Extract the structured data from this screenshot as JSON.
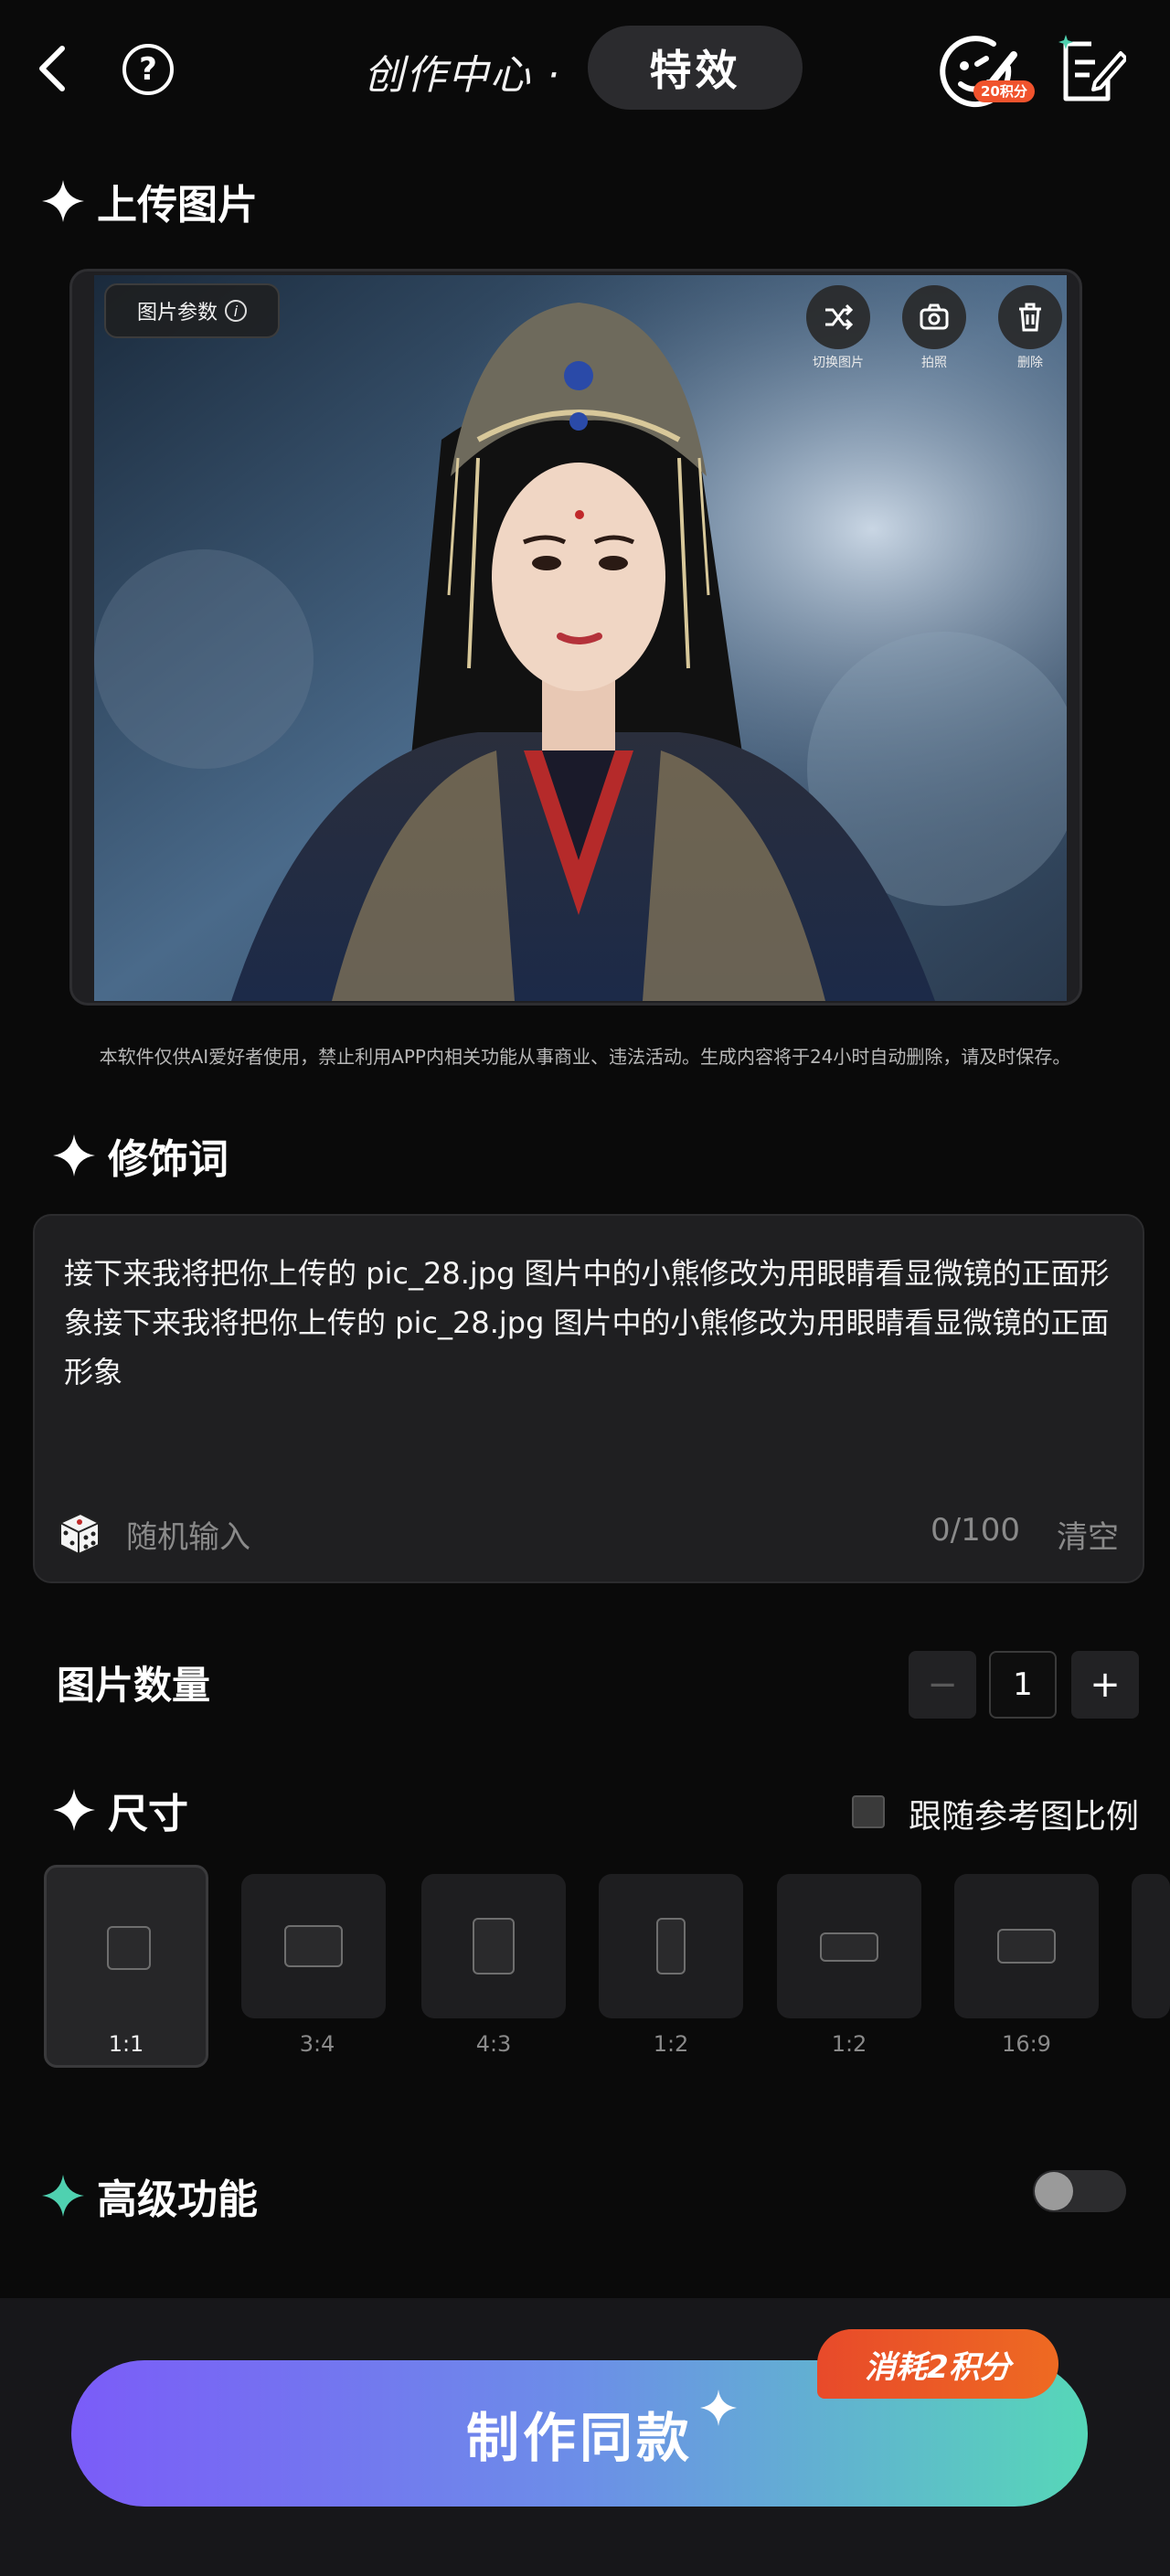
{
  "header": {
    "title": "创作中心 ·",
    "mode_pill": "特效",
    "points_badge": "20积分"
  },
  "upload": {
    "section_title": "上传图片",
    "param_pill": "图片参数",
    "tools": [
      {
        "label": "切换图片",
        "icon": "shuffle-icon"
      },
      {
        "label": "拍照",
        "icon": "camera-icon"
      },
      {
        "label": "删除",
        "icon": "trash-icon"
      }
    ],
    "disclaimer": "本软件仅供AI爱好者使用，禁止利用APP内相关功能从事商业、违法活动。生成内容将于24小时自动删除，请及时保存。"
  },
  "prompt": {
    "section_title": "修饰词",
    "text": "接下来我将把你上传的 pic_28.jpg 图片中的小熊修改为用眼睛看显微镜的正面形象接下来我将把你上传的 pic_28.jpg 图片中的小熊修改为用眼睛看显微镜的正面形象",
    "random_label": "随机输入",
    "counter": "0/100",
    "clear_label": "清空"
  },
  "quantity": {
    "label": "图片数量",
    "minus": "−",
    "value": "1",
    "plus": "+"
  },
  "size": {
    "section_title": "尺寸",
    "follow_label": "跟随参考图比例",
    "follow_checked": false,
    "ratios": [
      "1:1",
      "3:4",
      "4:3",
      "1:2",
      "1:2",
      "16:9"
    ],
    "selected_ratio": "1:1"
  },
  "advanced": {
    "section_title": "高级功能",
    "enabled": false
  },
  "footer": {
    "make_label": "制作同款",
    "cost_badge": "消耗2积分"
  },
  "colors": {
    "background": "#0a0a0a",
    "accent_teal": "#4fd1b0",
    "button_gradient_start": "#7b5cf8",
    "button_gradient_end": "#56d7b8",
    "badge_orange": "#e84a2a"
  }
}
